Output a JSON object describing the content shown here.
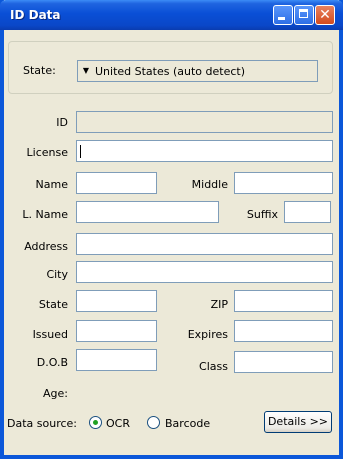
{
  "window": {
    "title": "ID Data"
  },
  "state_group": {
    "label": "State:",
    "selected": "United States (auto detect)"
  },
  "fields": {
    "id": "ID",
    "license": "License",
    "name": "Name",
    "middle": "Middle",
    "last_name": "L. Name",
    "suffix": "Suffix",
    "address": "Address",
    "city": "City",
    "state": "State",
    "zip": "ZIP",
    "issued": "Issued",
    "expires": "Expires",
    "dob": "D.O.B",
    "class": "Class",
    "age": "Age:"
  },
  "data_source": {
    "label": "Data source:",
    "options": [
      "OCR",
      "Barcode"
    ],
    "selected": "OCR"
  },
  "details_button": "Details >>"
}
